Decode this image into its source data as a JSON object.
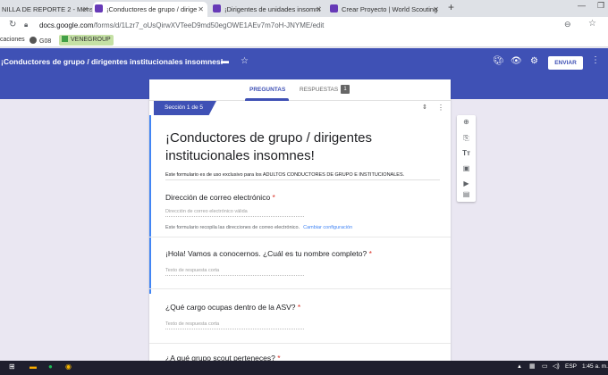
{
  "browser": {
    "tabs": [
      {
        "label": "NILLA DE REPORTE 2 - Mens",
        "color": "#1a73e8"
      },
      {
        "label": "¡Conductores de grupo / dirige",
        "color": "#673ab7"
      },
      {
        "label": "¡Dirigentes de unidades insomni",
        "color": "#673ab7"
      },
      {
        "label": "Crear Proyecto | World Scouting",
        "color": "#673ab7"
      }
    ],
    "url_domain": "docs.google.com",
    "url_path": "/forms/d/1Lzr7_oUsQirwXVTeeD9md50egOWE1AEv7m7oH-JNYME/edit",
    "bookmarks": [
      "caciones",
      "G08",
      "VENEGROUP"
    ]
  },
  "header": {
    "title": "¡Conductores de grupo / dirigentes institucionales insomnes!",
    "send_label": "ENVIAR",
    "color": "#3f51b5"
  },
  "form": {
    "tab_questions": "PREGUNTAS",
    "tab_responses": "RESPUESTAS",
    "responses_count": "1",
    "section_label": "Sección 1 de 5",
    "title": "¡Conductores de grupo / dirigentes institucionales insomnes!",
    "description": "Este formulario es de uso exclusivo para los ADULTOS CONDUCTORES DE GRUPO E INSTITUCIONALES.",
    "email_question": "Dirección de correo electrónico",
    "email_placeholder": "Dirección de correo electrónico válida",
    "email_note": "Este formulario recopila las direcciones de correo electrónico.",
    "email_note_link": "Cambiar configuración",
    "q1": "¡Hola! Vamos a conocernos. ¿Cuál es tu nombre completo?",
    "q1_placeholder": "Texto de respuesta corta",
    "q2": "¿Qué cargo ocupas dentro de la ASV?",
    "q2_placeholder": "Texto de respuesta corta",
    "q3": "¿A qué grupo scout perteneces?",
    "required_mark": "*"
  },
  "taskbar": {
    "lang": "ESP",
    "time": "1:45 a. m."
  }
}
